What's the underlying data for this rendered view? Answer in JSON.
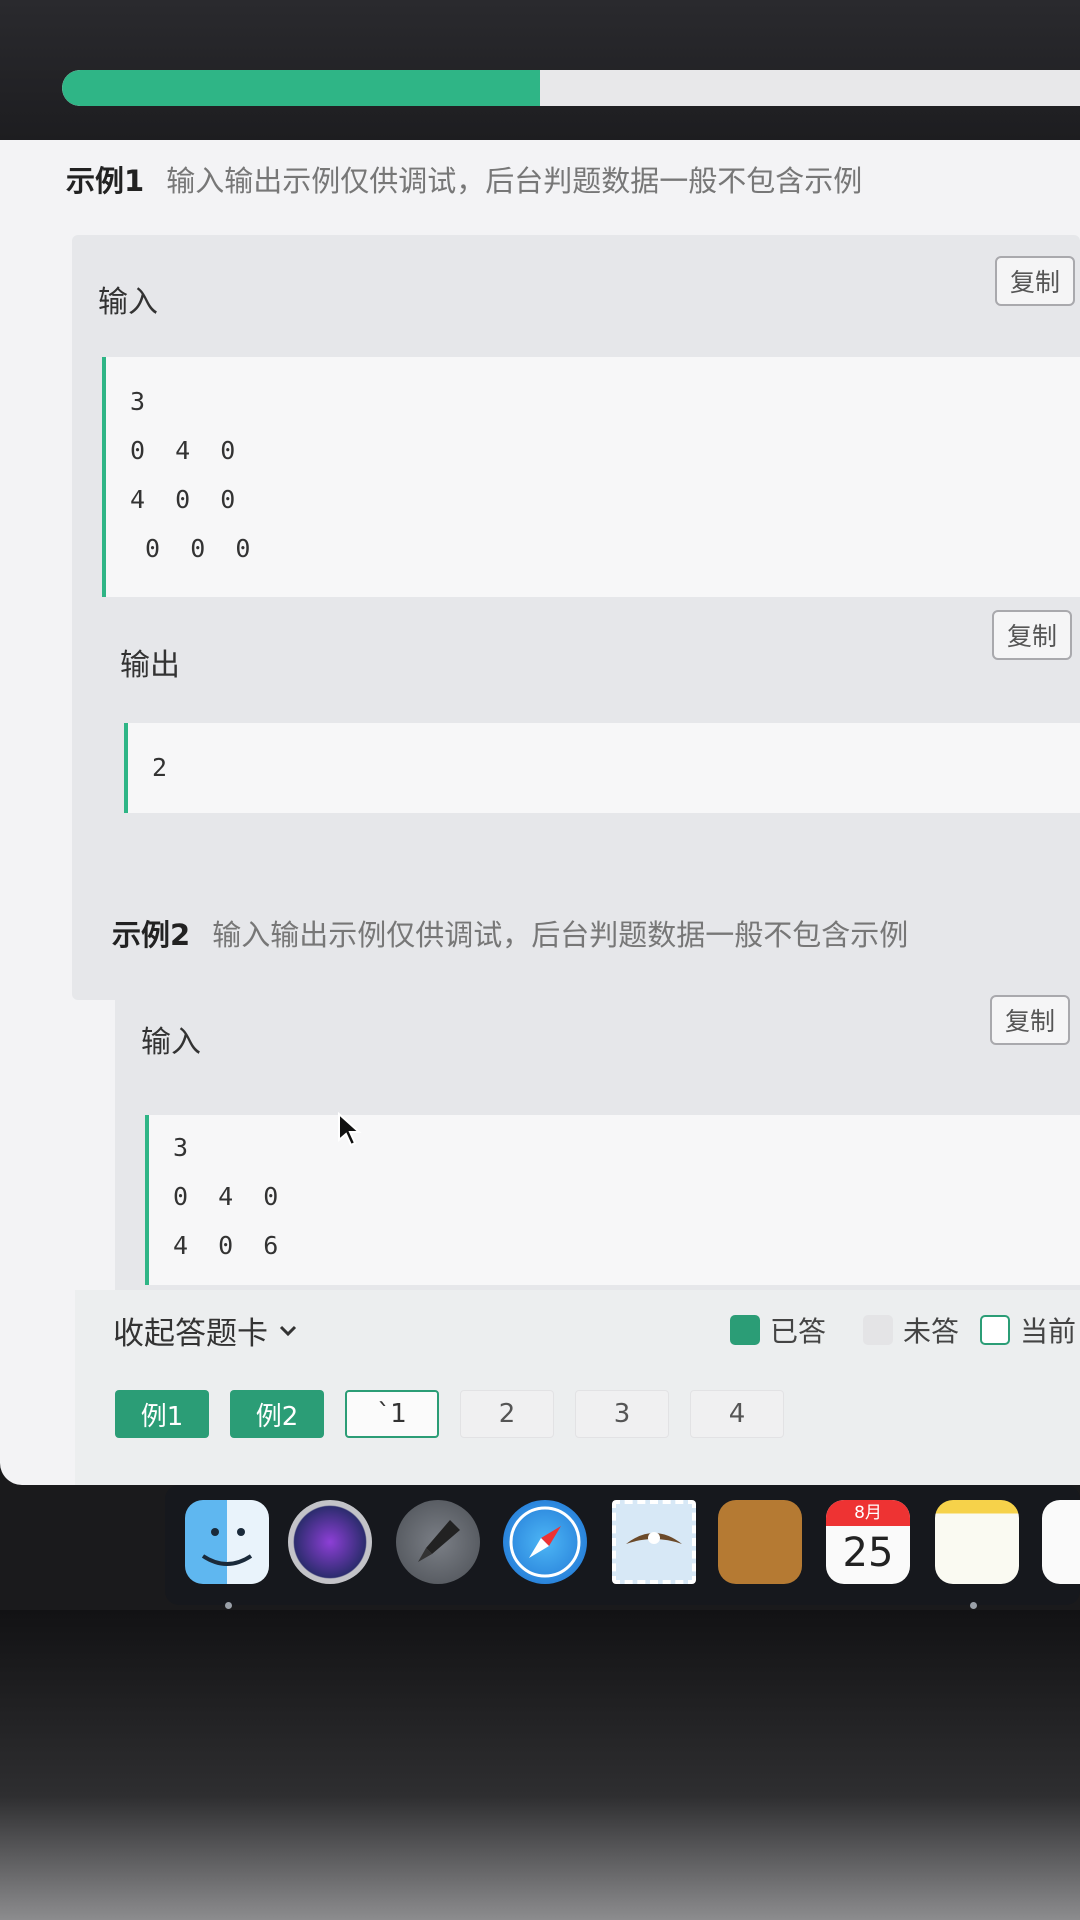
{
  "progress": {
    "fraction": 0.47
  },
  "examples": [
    {
      "title": "示例1",
      "description": "输入输出示例仅供调试，后台判题数据一般不包含示例",
      "input_label": "输入",
      "input_copy": "复制",
      "input_lines": [
        "3",
        "0  4  0",
        "4  0  0",
        " 0  0  0"
      ],
      "output_label": "输出",
      "output_copy": "复制",
      "output_lines": [
        "2"
      ]
    },
    {
      "title": "示例2",
      "description": "输入输出示例仅供调试，后台判题数据一般不包含示例",
      "input_label": "输入",
      "input_copy": "复制",
      "input_lines": [
        "3",
        "0  4  0",
        "4  0  6"
      ]
    }
  ],
  "answer_card": {
    "collapse_label": "收起答题卡",
    "legend": {
      "answered": "已答",
      "unanswered": "未答",
      "current": "当前"
    },
    "questions": [
      {
        "label": "例1",
        "state": "done"
      },
      {
        "label": "例2",
        "state": "done"
      },
      {
        "label": "`1",
        "state": "current"
      },
      {
        "label": "2",
        "state": "todo"
      },
      {
        "label": "3",
        "state": "todo"
      },
      {
        "label": "4",
        "state": "todo"
      }
    ]
  },
  "dock": {
    "apps": [
      "finder-icon",
      "siri-icon",
      "launchpad-icon",
      "safari-icon",
      "mail-icon",
      "contacts-icon",
      "calendar-icon",
      "notes-icon",
      "reminders-icon"
    ],
    "calendar": {
      "month": "8月",
      "day": "25"
    }
  },
  "colors": {
    "accent": "#2fb586",
    "accent_dark": "#2b9d76"
  }
}
